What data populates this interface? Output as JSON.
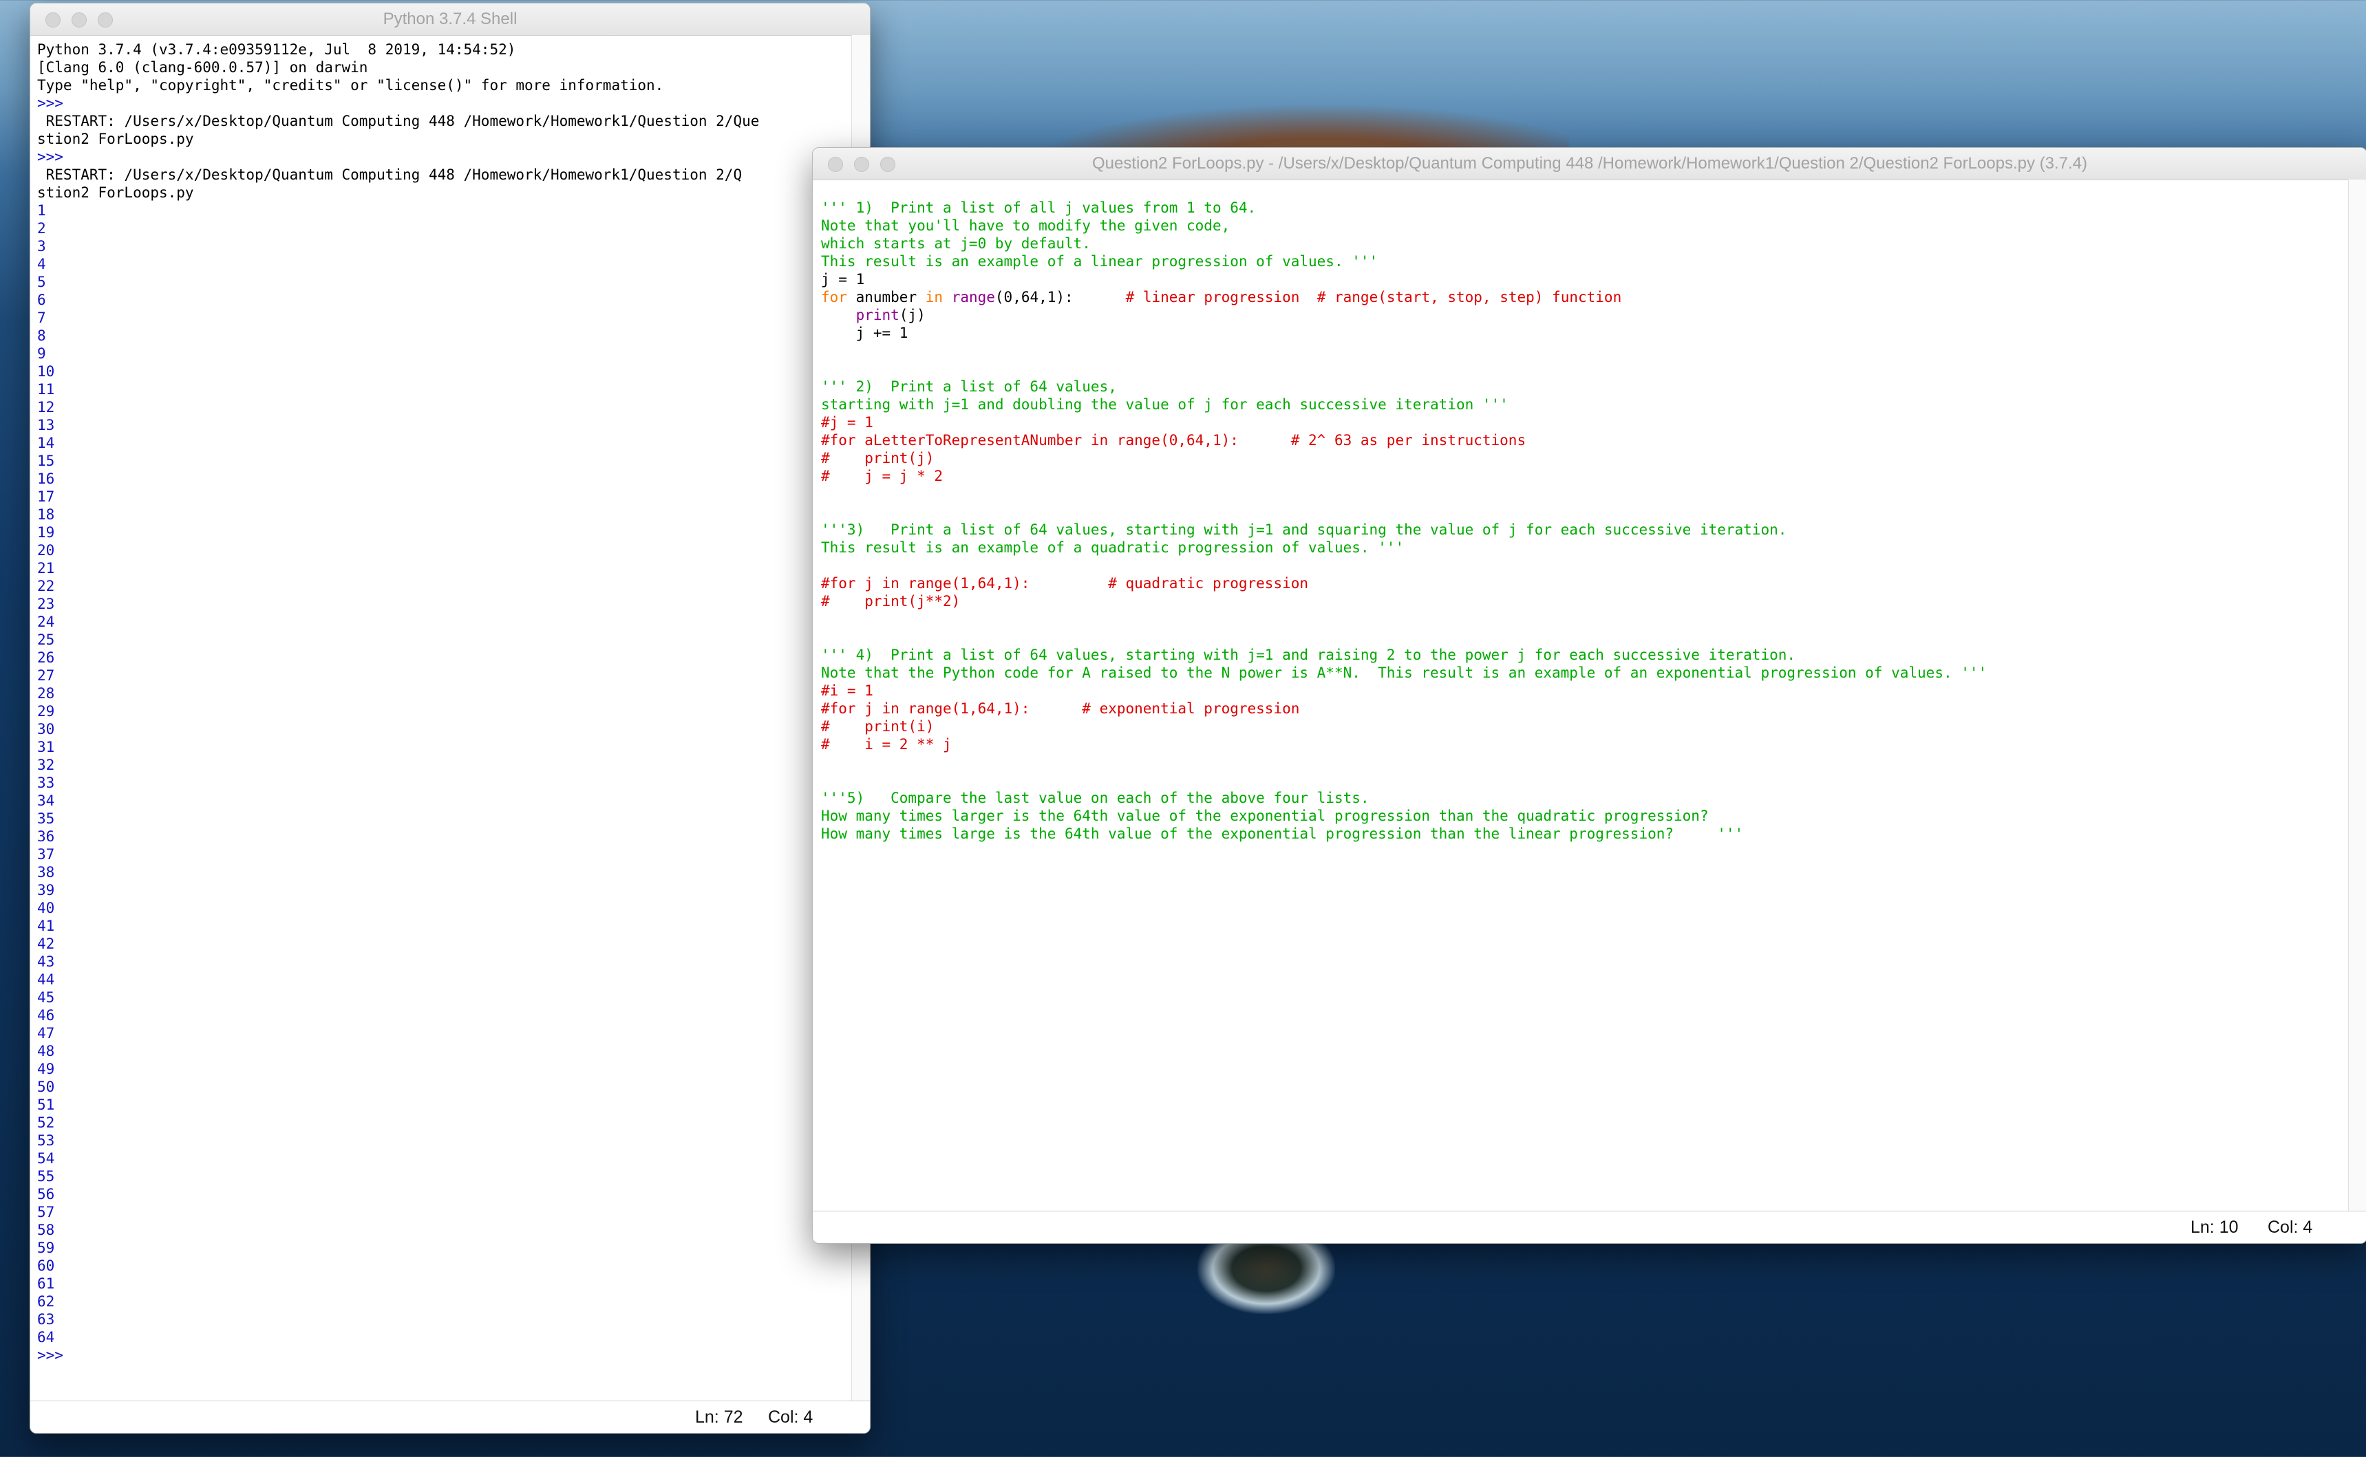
{
  "shell": {
    "title": "Python 3.7.4 Shell",
    "banner": [
      "Python 3.7.4 (v3.7.4:e09359112e, Jul  8 2019, 14:54:52) ",
      "[Clang 6.0 (clang-600.0.57)] on darwin",
      "Type \"help\", \"copyright\", \"credits\" or \"license()\" for more information."
    ],
    "prompt": ">>> ",
    "restart1": [
      " RESTART: /Users/x/Desktop/Quantum Computing 448 /Homework/Homework1/Question 2/Que",
      "stion2 ForLoops.py "
    ],
    "restart2": [
      " RESTART: /Users/x/Desktop/Quantum Computing 448 /Homework/Homework1/Question 2/Q",
      "stion2 ForLoops.py "
    ],
    "output": [
      "1",
      "2",
      "3",
      "4",
      "5",
      "6",
      "7",
      "8",
      "9",
      "10",
      "11",
      "12",
      "13",
      "14",
      "15",
      "16",
      "17",
      "18",
      "19",
      "20",
      "21",
      "22",
      "23",
      "24",
      "25",
      "26",
      "27",
      "28",
      "29",
      "30",
      "31",
      "32",
      "33",
      "34",
      "35",
      "36",
      "37",
      "38",
      "39",
      "40",
      "41",
      "42",
      "43",
      "44",
      "45",
      "46",
      "47",
      "48",
      "49",
      "50",
      "51",
      "52",
      "53",
      "54",
      "55",
      "56",
      "57",
      "58",
      "59",
      "60",
      "61",
      "62",
      "63",
      "64"
    ],
    "final_prompt": ">>> ",
    "status_ln": "Ln: 72",
    "status_col": "Col: 4"
  },
  "editor": {
    "title": "Question2 ForLoops.py - /Users/x/Desktop/Quantum Computing 448 /Homework/Homework1/Question 2/Question2 ForLoops.py (3.7.4)",
    "lines": [
      [
        {
          "t": "''' 1)  Print a list of all j values from 1 to 64.",
          "c": "green"
        }
      ],
      [
        {
          "t": "Note that you'll have to modify the given code,",
          "c": "green"
        }
      ],
      [
        {
          "t": "which starts at j=0 by default.",
          "c": "green"
        }
      ],
      [
        {
          "t": "This result is an example of a linear progression of values. '''",
          "c": "green"
        }
      ],
      [
        {
          "t": "j = 1",
          "c": "black"
        }
      ],
      [
        {
          "t": "for",
          "c": "orange"
        },
        {
          "t": " anumber ",
          "c": "black"
        },
        {
          "t": "in",
          "c": "orange"
        },
        {
          "t": " ",
          "c": "black"
        },
        {
          "t": "range",
          "c": "purple"
        },
        {
          "t": "(0,64,1):      ",
          "c": "black"
        },
        {
          "t": "# linear progression  # range(start, stop, step) function",
          "c": "red"
        }
      ],
      [
        {
          "t": "    ",
          "c": "black"
        },
        {
          "t": "print",
          "c": "purple"
        },
        {
          "t": "(j)",
          "c": "black"
        }
      ],
      [
        {
          "t": "    j += 1",
          "c": "black"
        }
      ],
      [
        {
          "t": "",
          "c": "black"
        }
      ],
      [
        {
          "t": "",
          "c": "black"
        }
      ],
      [
        {
          "t": "''' 2)  Print a list of 64 values,",
          "c": "green"
        }
      ],
      [
        {
          "t": "starting with j=1 and doubling the value of j for each successive iteration '''",
          "c": "green"
        }
      ],
      [
        {
          "t": "#j = 1",
          "c": "red"
        }
      ],
      [
        {
          "t": "#for aLetterToRepresentANumber in range(0,64,1):      # 2^ 63 as per instructions",
          "c": "red"
        }
      ],
      [
        {
          "t": "#    print(j)",
          "c": "red"
        }
      ],
      [
        {
          "t": "#    j = j * 2",
          "c": "red"
        }
      ],
      [
        {
          "t": "",
          "c": "black"
        }
      ],
      [
        {
          "t": "",
          "c": "black"
        }
      ],
      [
        {
          "t": "'''3)   Print a list of 64 values, starting with j=1 and squaring the value of j for each successive iteration.",
          "c": "green"
        }
      ],
      [
        {
          "t": "This result is an example of a quadratic progression of values. '''",
          "c": "green"
        }
      ],
      [
        {
          "t": "",
          "c": "black"
        }
      ],
      [
        {
          "t": "#for j in range(1,64,1):         # quadratic progression",
          "c": "red"
        }
      ],
      [
        {
          "t": "#    print(j**2)",
          "c": "red"
        }
      ],
      [
        {
          "t": "",
          "c": "black"
        }
      ],
      [
        {
          "t": "",
          "c": "black"
        }
      ],
      [
        {
          "t": "''' 4)  Print a list of 64 values, starting with j=1 and raising 2 to the power j for each successive iteration.",
          "c": "green"
        }
      ],
      [
        {
          "t": "Note that the Python code for A raised to the N power is A**N.  This result is an example of an exponential progression of values. '''",
          "c": "green"
        }
      ],
      [
        {
          "t": "#i = 1",
          "c": "red"
        }
      ],
      [
        {
          "t": "#for j in range(1,64,1):      # exponential progression",
          "c": "red"
        }
      ],
      [
        {
          "t": "#    print(i)",
          "c": "red"
        }
      ],
      [
        {
          "t": "#    i = 2 ** j",
          "c": "red"
        }
      ],
      [
        {
          "t": "",
          "c": "black"
        }
      ],
      [
        {
          "t": "",
          "c": "black"
        }
      ],
      [
        {
          "t": "'''5)   Compare the last value on each of the above four lists.",
          "c": "green"
        }
      ],
      [
        {
          "t": "How many times larger is the 64th value of the exponential progression than the quadratic progression?",
          "c": "green"
        }
      ],
      [
        {
          "t": "How many times large is the 64th value of the exponential progression than the linear progression?     '''",
          "c": "green"
        }
      ]
    ],
    "status_ln": "Ln: 10",
    "status_col": "Col: 4"
  },
  "colors": {
    "black": "#000000",
    "blue": "#1010c8",
    "red": "#dd0000",
    "green": "#00aa00",
    "orange": "#ff7700",
    "purple": "#900090"
  }
}
